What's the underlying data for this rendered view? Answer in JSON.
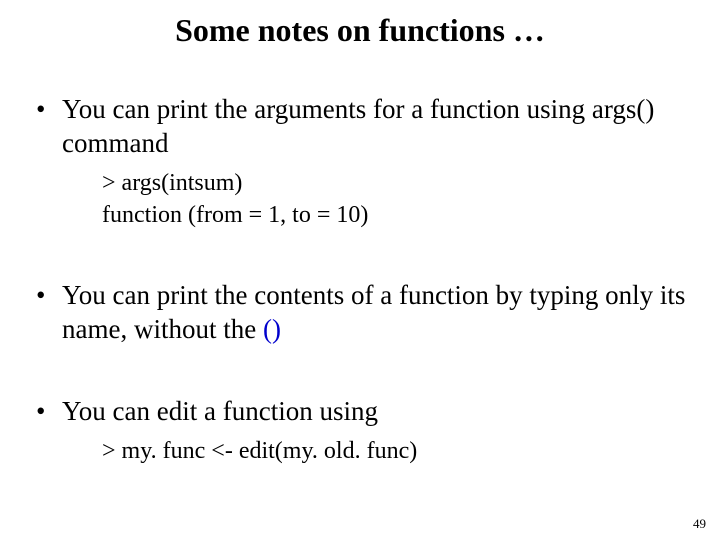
{
  "title": "Some notes on functions …",
  "bullets": [
    {
      "text": "You can print the arguments for a function using args() command",
      "sub": [
        "> args(intsum)",
        "function (from = 1, to = 10)"
      ]
    },
    {
      "text_before": "You can print the contents of a function by typing only its name, without the ",
      "paren": "()"
    },
    {
      "text": "You can edit a function using",
      "sub": [
        "> my. func <- edit(my. old. func)"
      ]
    }
  ],
  "page_number": "49"
}
